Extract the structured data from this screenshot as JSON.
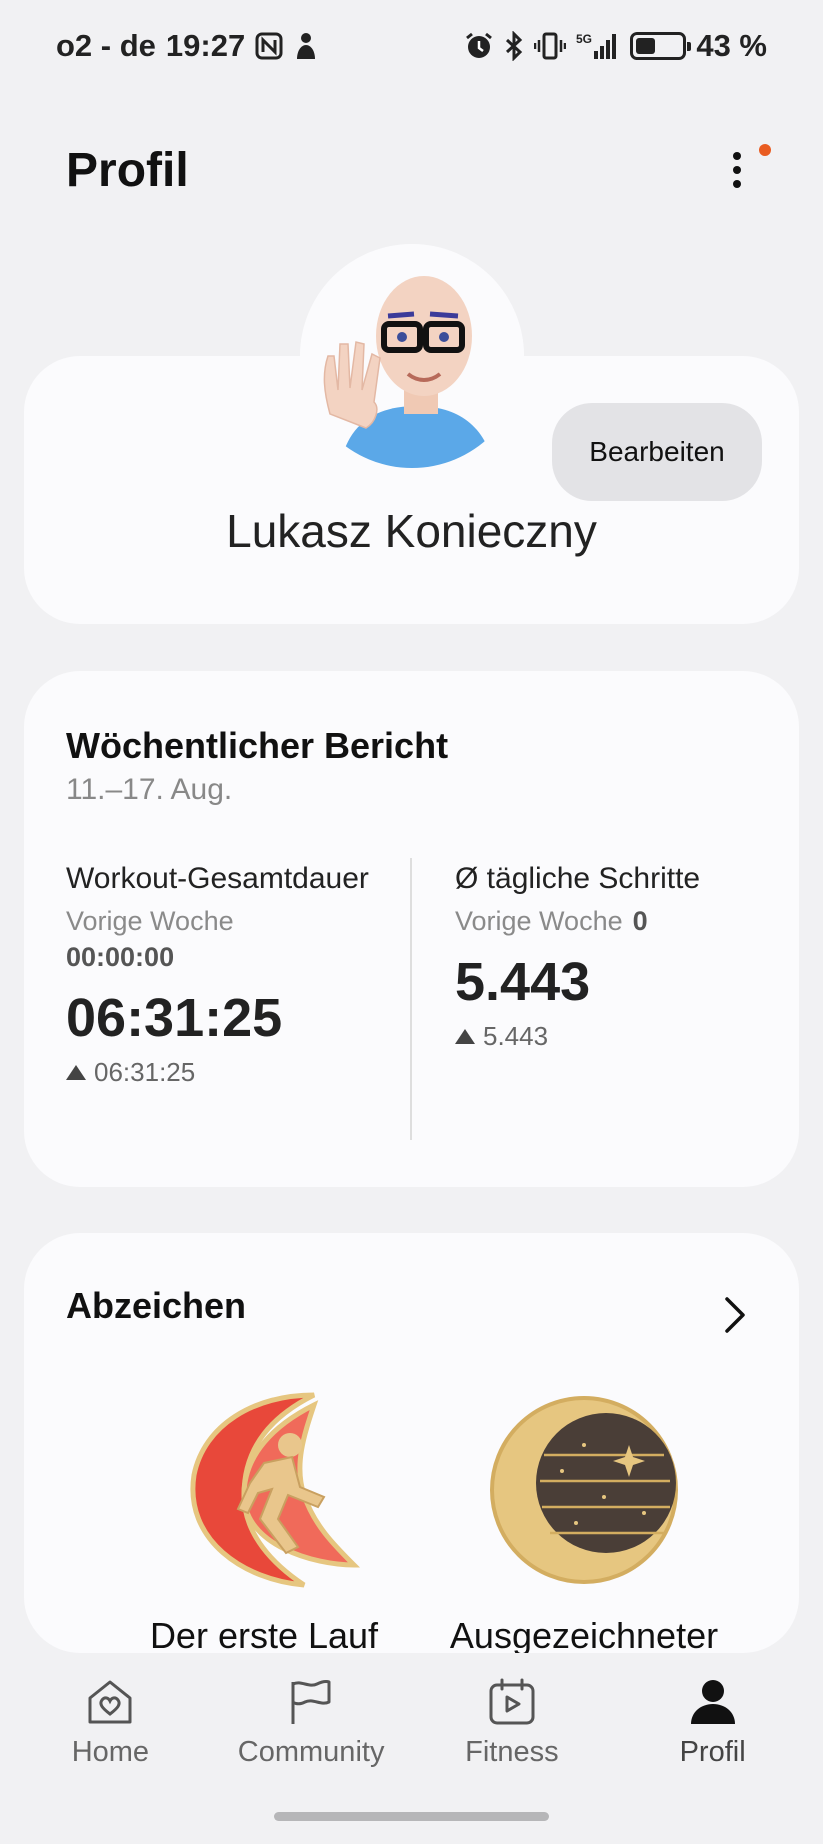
{
  "status_bar": {
    "carrier": "o2 - de",
    "time": "19:27",
    "network": "5G",
    "battery_percent": "43 %",
    "battery_level": 0.43
  },
  "header": {
    "title": "Profil"
  },
  "profile": {
    "name": "Lukasz Konieczny",
    "edit_label": "Bearbeiten"
  },
  "weekly_report": {
    "title": "Wöchentlicher Bericht",
    "dates": "11.–17. Aug.",
    "workout": {
      "label": "Workout-Gesamtdauer",
      "prev_label": "Vorige Woche",
      "prev_value": "00:00:00",
      "value": "06:31:25",
      "delta": "06:31:25"
    },
    "steps": {
      "label": "Ø tägliche Schritte",
      "prev_label": "Vorige Woche",
      "prev_value": "0",
      "value": "5.443",
      "delta": "5.443"
    }
  },
  "badges": {
    "title": "Abzeichen",
    "items": [
      {
        "name": "Der erste Lauf",
        "icon": "runner-badge-icon"
      },
      {
        "name": "Ausgezeichneter",
        "icon": "moon-badge-icon"
      }
    ]
  },
  "bottom_nav": [
    {
      "label": "Home",
      "icon": "home-heart-icon",
      "active": false
    },
    {
      "label": "Community",
      "icon": "flag-icon",
      "active": false
    },
    {
      "label": "Fitness",
      "icon": "calendar-play-icon",
      "active": false
    },
    {
      "label": "Profil",
      "icon": "person-icon",
      "active": true
    }
  ],
  "colors": {
    "background": "#f1f1f3",
    "card": "#fbfbfd",
    "notification_dot": "#e95c21",
    "badge_red": "#e8483a",
    "badge_gold": "#e6c680"
  }
}
